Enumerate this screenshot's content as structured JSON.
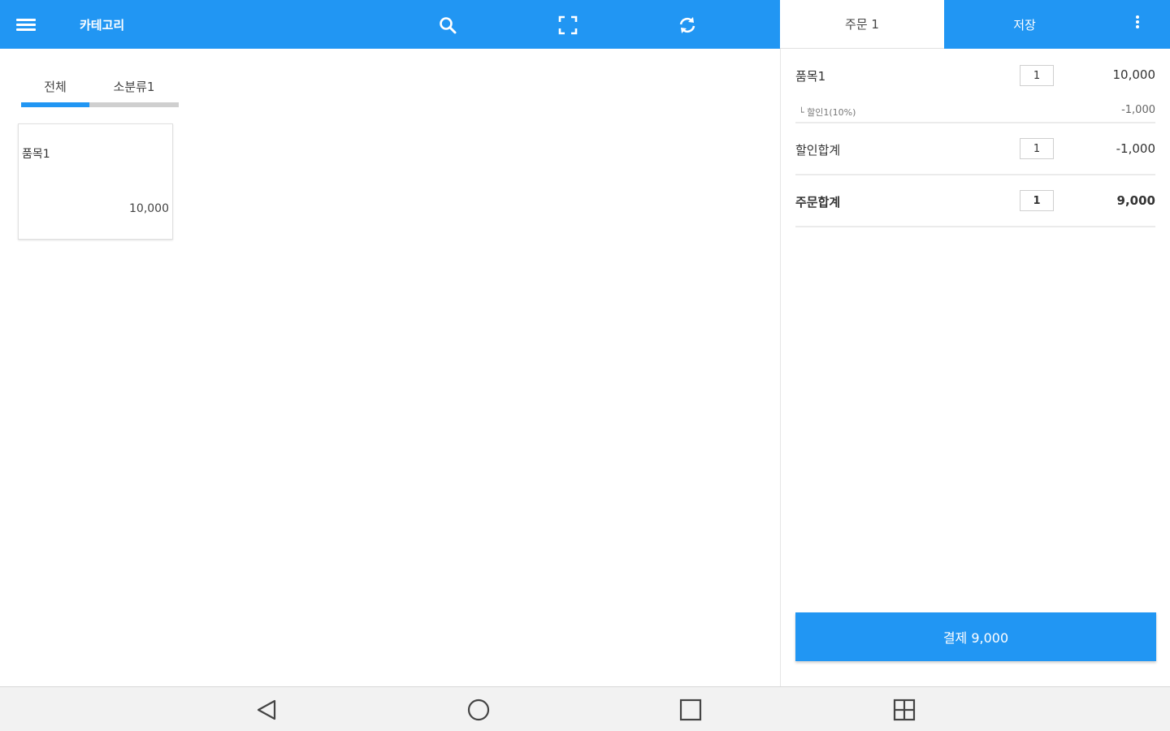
{
  "appbar": {
    "title": "카테고리",
    "icons": [
      "menu-icon",
      "search-icon",
      "fullscreen-icon",
      "refresh-icon"
    ]
  },
  "header_tabs": {
    "order": "주문 1",
    "save": "저장",
    "more_icon": "more-vert-icon"
  },
  "categories": {
    "tabs": [
      "전체",
      "소분류1"
    ],
    "selected_index": 0
  },
  "products": [
    {
      "name": "품목1",
      "price": "10,000"
    }
  ],
  "order": {
    "items": [
      {
        "name": "품목1",
        "qty": "1",
        "amount": "10,000",
        "discount": {
          "label": "└ 할인1(10%)",
          "amount": "-1,000"
        }
      }
    ],
    "discount_total": {
      "label": "할인합계",
      "qty": "1",
      "amount": "-1,000"
    },
    "order_total": {
      "label": "주문합계",
      "qty": "1",
      "amount": "9,000"
    }
  },
  "pay_button": "결제 9,000",
  "colors": {
    "primary": "#2196f3",
    "navbar_bg": "#f2f2f2"
  },
  "navbar": {
    "icons": [
      "back-icon",
      "home-icon",
      "recent-apps-icon",
      "split-screen-icon"
    ]
  }
}
